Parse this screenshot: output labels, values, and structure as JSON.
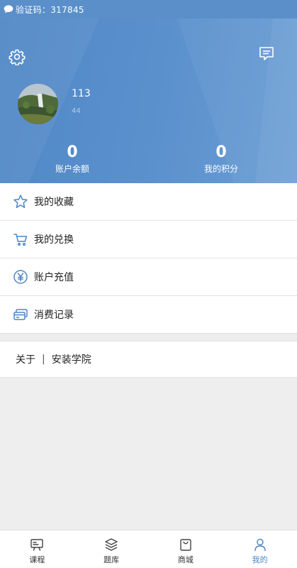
{
  "notification": {
    "text": "验证码：317845",
    "icon": "chat-bubble-icon"
  },
  "header": {
    "settings_icon": "gear-icon",
    "message_icon": "message-icon",
    "user": {
      "name": "113",
      "id": "44"
    },
    "stats": [
      {
        "value": "0",
        "label": "账户余额"
      },
      {
        "value": "0",
        "label": "我的积分"
      }
    ],
    "accent_color": "#5a8fc9"
  },
  "menu": {
    "items": [
      {
        "label": "我的收藏",
        "icon": "star-icon"
      },
      {
        "label": "我的兑换",
        "icon": "cart-icon"
      },
      {
        "label": "账户充值",
        "icon": "yuan-icon"
      },
      {
        "label": "消费记录",
        "icon": "card-icon"
      }
    ]
  },
  "about": {
    "label": "关于",
    "separator": "|",
    "name": "安装学院"
  },
  "tabbar": {
    "tabs": [
      {
        "label": "课程",
        "icon": "course-board-icon"
      },
      {
        "label": "题库",
        "icon": "layers-icon"
      },
      {
        "label": "商城",
        "icon": "shopping-bag-icon"
      },
      {
        "label": "我的",
        "icon": "person-icon"
      }
    ],
    "active_index": 3,
    "active_color": "#4c85c4"
  }
}
